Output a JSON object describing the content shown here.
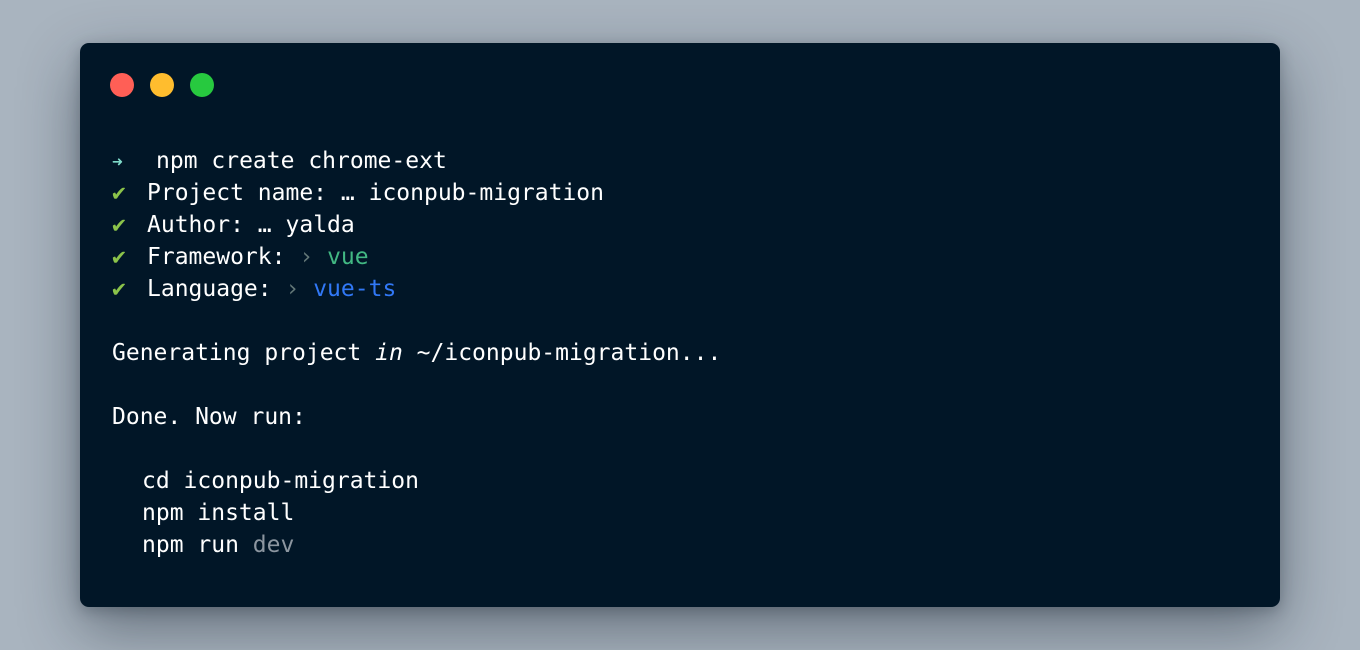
{
  "colors": {
    "background": "#a9b4bf",
    "terminal_bg": "#011627",
    "text": "#ffffff",
    "prompt_arrow": "#7fdbca",
    "check": "#8bc34a",
    "chevron": "#637777",
    "vue": "#42b883",
    "vue_ts": "#3178f6",
    "dim": "#8c96a0",
    "close_dot": "#ff5f56",
    "minimize_dot": "#ffbd2e",
    "zoom_dot": "#27c93f"
  },
  "window_controls": {
    "close": "close-dot",
    "minimize": "minimize-dot",
    "zoom": "zoom-dot"
  },
  "prompt": {
    "arrow": "➜",
    "command": "npm create chrome-ext"
  },
  "answers": [
    {
      "check": "✔",
      "label": "Project name:",
      "separator": "…",
      "value": "iconpub-migration"
    },
    {
      "check": "✔",
      "label": "Author:",
      "separator": "…",
      "value": "yalda"
    },
    {
      "check": "✔",
      "label": "Framework:",
      "separator": "›",
      "value": "vue"
    },
    {
      "check": "✔",
      "label": "Language:",
      "separator": "›",
      "value": "vue-ts"
    }
  ],
  "generating": {
    "prefix": "Generating project",
    "keyword": "in",
    "path": "~/iconpub-migration..."
  },
  "done": "Done. Now run:",
  "commands": [
    {
      "text": "cd iconpub-migration",
      "suffix": ""
    },
    {
      "text": "npm install",
      "suffix": ""
    },
    {
      "text": "npm run",
      "suffix": "dev"
    }
  ]
}
